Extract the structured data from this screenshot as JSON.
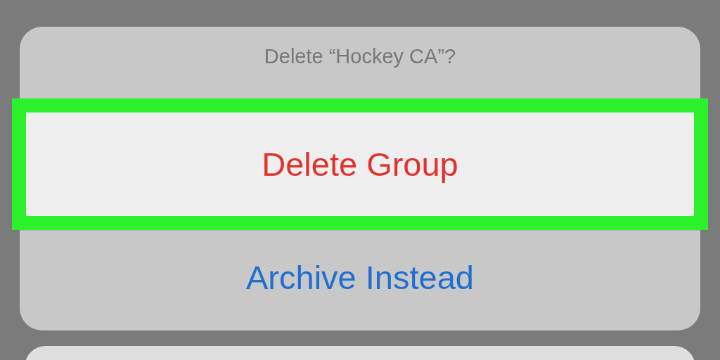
{
  "action_sheet": {
    "title": "Delete “Hockey CA”?",
    "actions": [
      {
        "label": "Delete Group",
        "kind": "destructive",
        "highlighted": true
      },
      {
        "label": "Archive Instead",
        "kind": "default",
        "highlighted": false
      }
    ]
  },
  "next_sheet": {
    "kind": "panel"
  }
}
